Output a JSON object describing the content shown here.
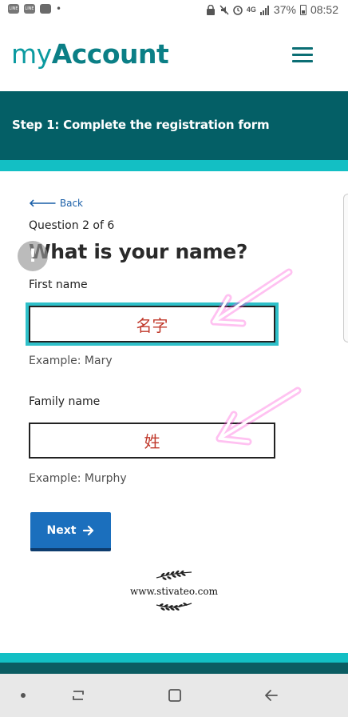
{
  "status_bar": {
    "left_icons": [
      "line-app-icon",
      "line-app-icon",
      "gallery-icon"
    ],
    "network": "4G",
    "battery": "37%",
    "time": "08:52"
  },
  "header": {
    "logo_my": "my",
    "logo_account": "Account",
    "menu_icon": "hamburger-menu-icon"
  },
  "banner": {
    "title": "Step 1: Complete the registration form"
  },
  "form": {
    "back_label": "Back",
    "progress": "Question 2 of 6",
    "title": "What is your name?",
    "help_bubble": "!",
    "first_name": {
      "label": "First name",
      "value": "名字",
      "hint": "Example: Mary"
    },
    "family_name": {
      "label": "Family name",
      "value": "姓",
      "hint": "Example: Murphy"
    },
    "next_label": "Next"
  },
  "watermark": {
    "text": "www.stivateo.com"
  },
  "colors": {
    "brand_teal": "#0b9aa0",
    "banner": "#045f66",
    "accent": "#13bfc4",
    "button": "#1b6fbd",
    "annotation": "#ff4fd8"
  }
}
